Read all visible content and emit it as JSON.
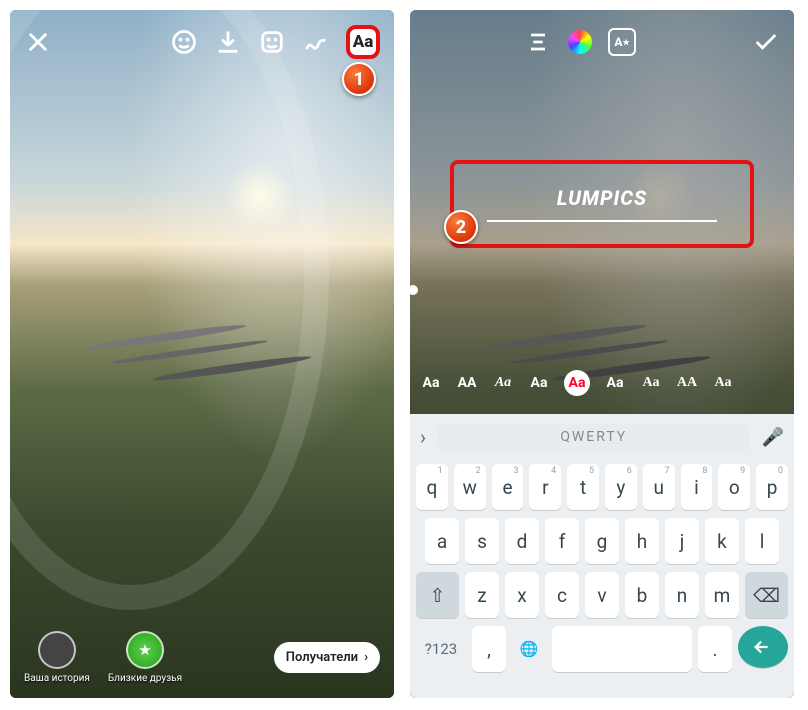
{
  "left": {
    "toolbar": {
      "close_icon": "close-icon",
      "face_icon": "face-sticker-icon",
      "download_icon": "download-icon",
      "sticker_icon": "sticker-icon",
      "draw_icon": "draw-icon",
      "text_label": "Aa"
    },
    "bottom": {
      "your_story": "Ваша история",
      "close_friends": "Близкие друзья",
      "recipients": "Получатели"
    },
    "badge": "1"
  },
  "right": {
    "toolbar": {
      "align_icon": "align-icon",
      "color_icon": "color-wheel-icon",
      "style_icon": "text-style-icon",
      "style_label": "A",
      "done_icon": "checkmark-icon"
    },
    "typed_text": "LUMPICS",
    "font_options": [
      "Aa",
      "AA",
      "Aa",
      "Aa",
      "Aa",
      "Aa",
      "Aa",
      "AA",
      "Aa"
    ],
    "selected_font_index": 4,
    "badge": "2",
    "keyboard": {
      "suggestion": "QWERTY",
      "row1": [
        {
          "k": "q",
          "n": "1"
        },
        {
          "k": "w",
          "n": "2"
        },
        {
          "k": "e",
          "n": "3"
        },
        {
          "k": "r",
          "n": "4"
        },
        {
          "k": "t",
          "n": "5"
        },
        {
          "k": "y",
          "n": "6"
        },
        {
          "k": "u",
          "n": "7"
        },
        {
          "k": "i",
          "n": "8"
        },
        {
          "k": "o",
          "n": "9"
        },
        {
          "k": "p",
          "n": "0"
        }
      ],
      "row2": [
        "a",
        "s",
        "d",
        "f",
        "g",
        "h",
        "j",
        "k",
        "l"
      ],
      "row3": [
        "z",
        "x",
        "c",
        "v",
        "b",
        "n",
        "m"
      ],
      "shift": "⇧",
      "backspace": "⌫",
      "sym": "?123",
      "comma": ",",
      "lang": "🌐",
      "period": ".",
      "enter": "←"
    }
  }
}
